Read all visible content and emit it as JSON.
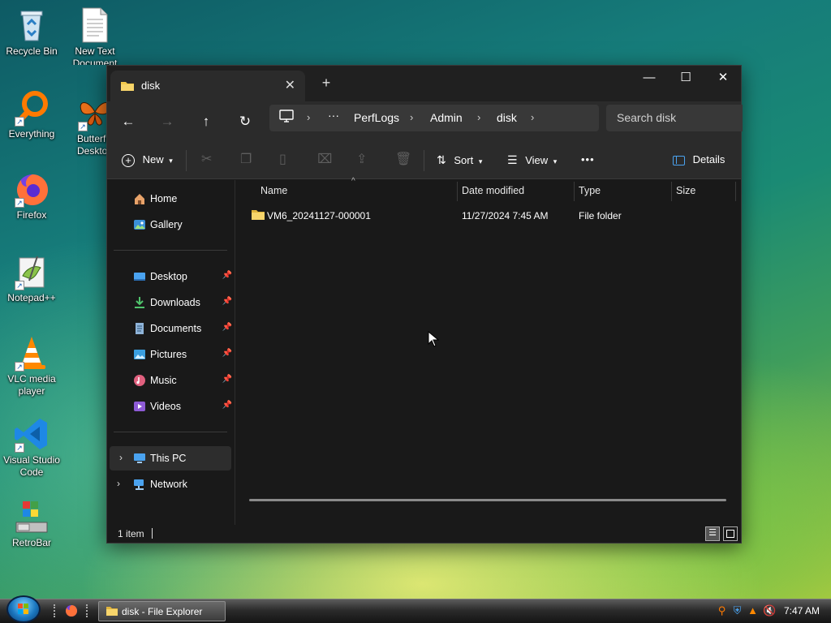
{
  "desktop": {
    "icons": [
      {
        "label": "Recycle Bin"
      },
      {
        "label": "New Text Document"
      },
      {
        "label": "Everything"
      },
      {
        "label": "Butterfly Desktop"
      },
      {
        "label": "Firefox"
      },
      {
        "label": "Notepad++"
      },
      {
        "label": "VLC media player"
      },
      {
        "label": "Visual Studio Code"
      },
      {
        "label": "RetroBar"
      }
    ]
  },
  "explorer": {
    "tab_title": "disk",
    "tab_close": "✕",
    "new_tab": "+",
    "window_buttons": {
      "minimize": "—",
      "maximize": "☐",
      "close": "✕"
    },
    "breadcrumb": [
      "PerfLogs",
      "Admin",
      "disk"
    ],
    "search_placeholder": "Search disk",
    "toolbar": {
      "new": "New",
      "sort": "Sort",
      "view": "View",
      "more": "•••",
      "details": "Details"
    },
    "sidebar": {
      "quick": [
        {
          "label": "Home"
        },
        {
          "label": "Gallery"
        }
      ],
      "pinned": [
        {
          "label": "Desktop"
        },
        {
          "label": "Downloads"
        },
        {
          "label": "Documents"
        },
        {
          "label": "Pictures"
        },
        {
          "label": "Music"
        },
        {
          "label": "Videos"
        }
      ],
      "drives": [
        {
          "label": "This PC"
        },
        {
          "label": "Network"
        }
      ]
    },
    "columns": [
      "Name",
      "Date modified",
      "Type",
      "Size"
    ],
    "files": [
      {
        "name": "VM6_20241127-000001",
        "modified": "11/27/2024 7:45 AM",
        "type": "File folder",
        "size": ""
      }
    ],
    "status": "1 item"
  },
  "taskbar": {
    "active_window": "disk - File Explorer",
    "clock": "7:47 AM"
  },
  "colors": {
    "folder": "#f2c94c",
    "accent": "#4aa3f0"
  }
}
